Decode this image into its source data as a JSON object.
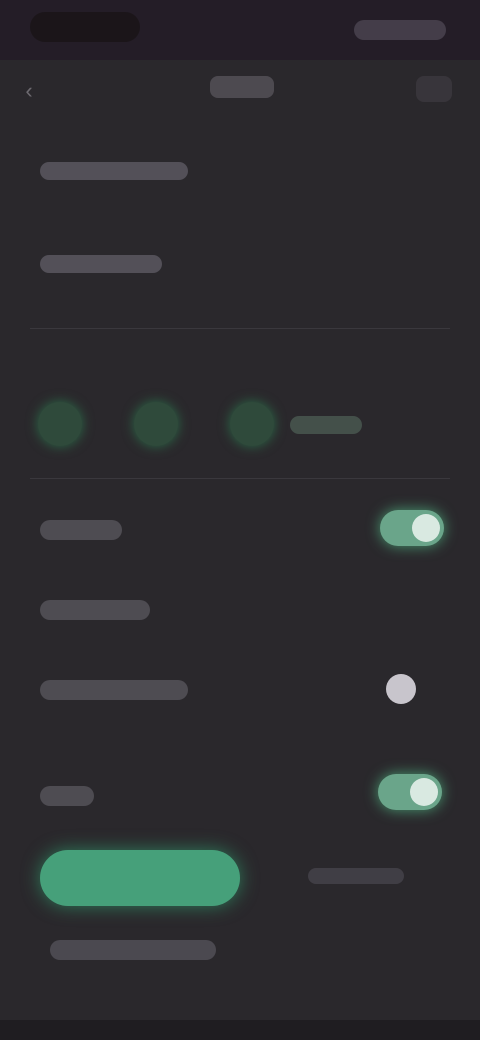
{
  "statusbar": {
    "time": "",
    "icons": ""
  },
  "appbar": {
    "title": "",
    "back_icon": "arrow-left-icon",
    "more_icon": "more-icon"
  },
  "steps": [
    {
      "icon": "step-1"
    },
    {
      "icon": "step-2"
    },
    {
      "icon": "step-3",
      "label": ""
    }
  ],
  "settings": [
    {
      "label": "",
      "toggle": "on"
    },
    {
      "label": ""
    },
    {
      "label": "",
      "toggle": "off"
    },
    {
      "label": "",
      "toggle": "on"
    }
  ],
  "actions": {
    "primary": "",
    "secondary": "",
    "link": ""
  },
  "colors": {
    "accent": "#46a07a",
    "background": "#2a282c"
  }
}
